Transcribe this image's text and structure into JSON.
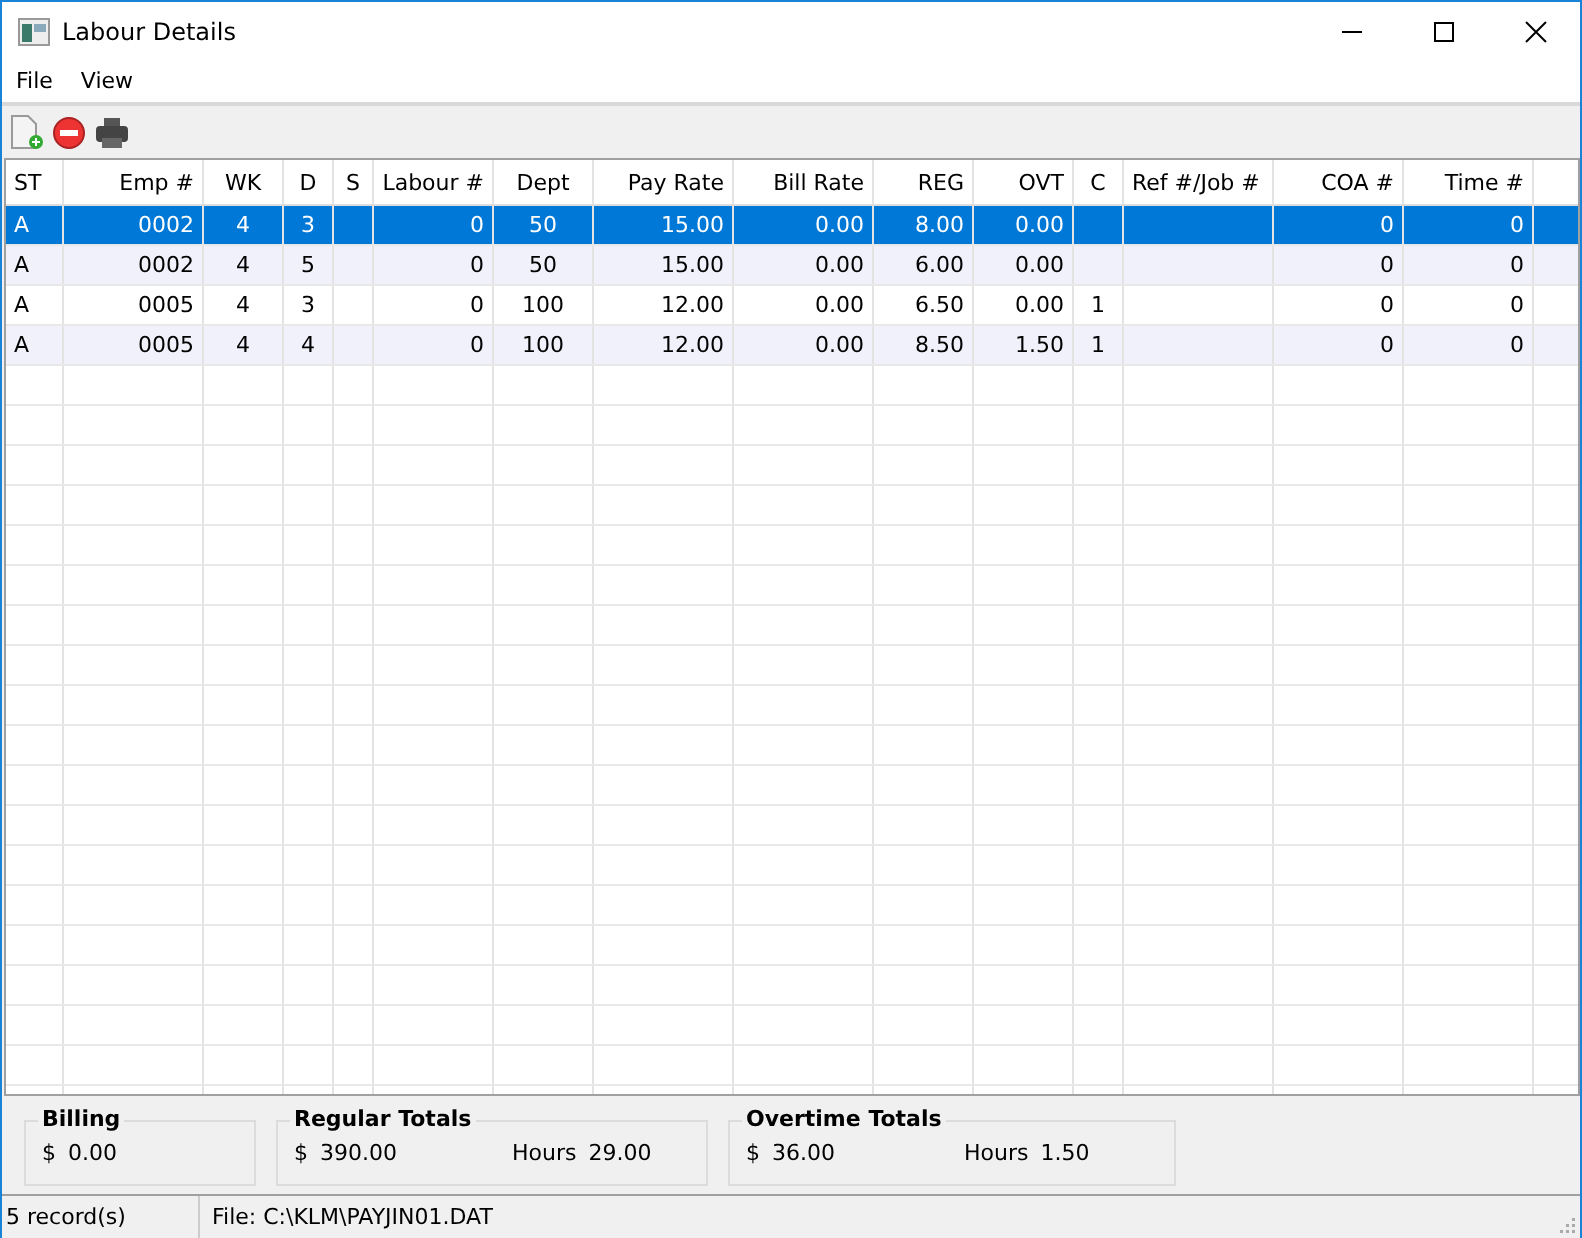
{
  "window": {
    "title": "Labour Details"
  },
  "menu": [
    "File",
    "View"
  ],
  "table": {
    "columns": [
      "ST",
      "Emp #",
      "WK",
      "D",
      "S",
      "Labour #",
      "Dept",
      "Pay Rate",
      "Bill Rate",
      "REG",
      "OVT",
      "C",
      "Ref #/Job #",
      "COA #",
      "Time #"
    ],
    "rows": [
      {
        "selected": true,
        "cells": [
          "A",
          "0002",
          "4",
          "3",
          null,
          "0",
          "50",
          "15.00",
          "0.00",
          "8.00",
          "0.00",
          null,
          null,
          "0",
          "0"
        ]
      },
      {
        "selected": false,
        "cells": [
          "A",
          "0002",
          "4",
          "5",
          null,
          "0",
          "50",
          "15.00",
          "0.00",
          "6.00",
          "0.00",
          null,
          null,
          "0",
          "0"
        ]
      },
      {
        "selected": false,
        "cells": [
          "A",
          "0005",
          "4",
          "3",
          null,
          "0",
          "100",
          "12.00",
          "0.00",
          "6.50",
          "0.00",
          "1",
          null,
          "0",
          "0"
        ]
      },
      {
        "selected": false,
        "cells": [
          "A",
          "0005",
          "4",
          "4",
          null,
          "0",
          "100",
          "12.00",
          "0.00",
          "8.50",
          "1.50",
          "1",
          null,
          "0",
          "0"
        ]
      }
    ]
  },
  "totals": [
    {
      "title": "Billing",
      "currency": "$",
      "amount": "0.00"
    },
    {
      "title": "Regular Totals",
      "currency": "$",
      "amount": "390.00",
      "hours_label": "Hours",
      "hours": "29.00"
    },
    {
      "title": "Overtime Totals",
      "currency": "$",
      "amount": "36.00",
      "hours_label": "Hours",
      "hours": "1.50"
    }
  ],
  "status_bar": {
    "records": "5 record(s)",
    "file": "File: C:\\KLM\\PAYJIN01.DAT"
  }
}
